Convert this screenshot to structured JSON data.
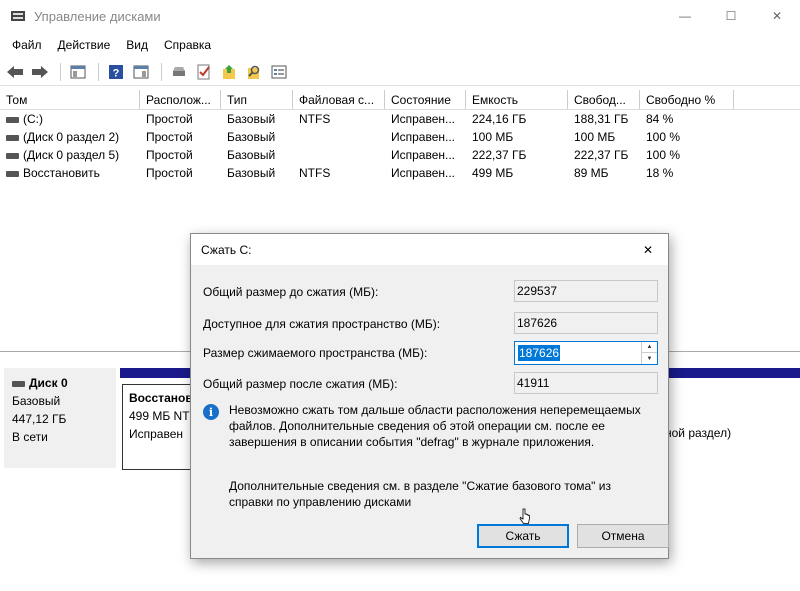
{
  "window": {
    "title": "Управление дисками",
    "min": "—",
    "max": "☐",
    "close": "✕"
  },
  "menu": [
    "Файл",
    "Действие",
    "Вид",
    "Справка"
  ],
  "volume_table": {
    "columns": [
      "Том",
      "Располож...",
      "Тип",
      "Файловая с...",
      "Состояние",
      "Емкость",
      "Свобод...",
      "Свободно %"
    ],
    "rows": [
      [
        "(C:)",
        "Простой",
        "Базовый",
        "NTFS",
        "Исправен...",
        "224,16 ГБ",
        "188,31 ГБ",
        "84 %"
      ],
      [
        "(Диск 0 раздел 2)",
        "Простой",
        "Базовый",
        "",
        "Исправен...",
        "100 МБ",
        "100 МБ",
        "100 %"
      ],
      [
        "(Диск 0 раздел 5)",
        "Простой",
        "Базовый",
        "",
        "Исправен...",
        "222,37 ГБ",
        "222,37 ГБ",
        "100 %"
      ],
      [
        "Восстановить",
        "Простой",
        "Базовый",
        "NTFS",
        "Исправен...",
        "499 МБ",
        "89 МБ",
        "18 %"
      ]
    ]
  },
  "disk": {
    "name": "Диск 0",
    "type": "Базовый",
    "size": "447,12 ГБ",
    "status": "В сети",
    "partition": {
      "name": "Восстанов",
      "size": "499 МБ NT",
      "status": "Исправен"
    },
    "right_partition_text": "ной раздел)"
  },
  "dialog": {
    "title": "Сжать C:",
    "close": "✕",
    "total_before_label": "Общий размер до сжатия (МБ):",
    "total_before_value": "229537",
    "available_label": "Доступное для сжатия пространство (МБ):",
    "available_value": "187626",
    "shrink_label": "Размер сжимаемого пространства (МБ):",
    "shrink_value": "187626",
    "total_after_label": "Общий размер после сжатия (МБ):",
    "total_after_value": "41911",
    "info_text": "Невозможно сжать том дальше области расположения неперемещаемых файлов. Дополнительные сведения об этой операции см. после ее завершения в описании события \"defrag\" в журнале приложения.",
    "help_text": "Дополнительные сведения см. в разделе \"Сжатие базового тома\" из справки по управлению дисками",
    "ok_label": "Сжать",
    "cancel_label": "Отмена"
  }
}
